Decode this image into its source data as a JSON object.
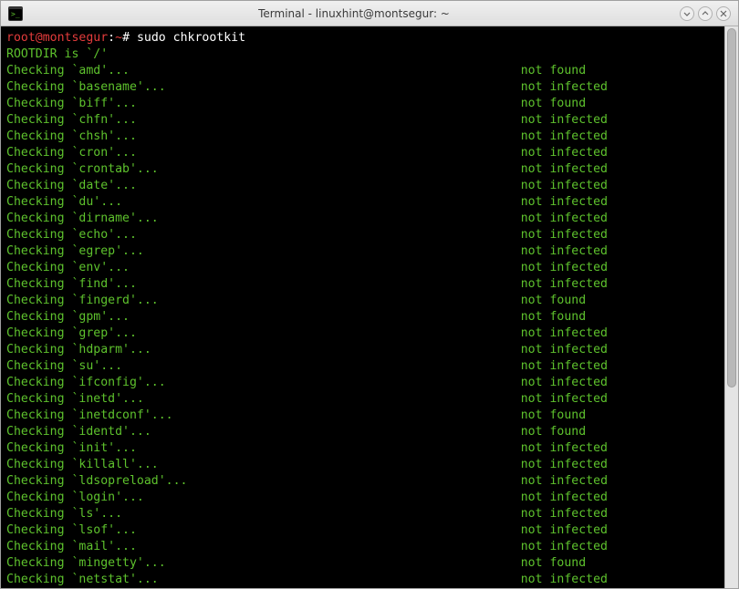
{
  "titlebar": {
    "title": "Terminal - linuxhint@montsegur: ~"
  },
  "prompt": {
    "user_host": "root@montsegur",
    "path": "~",
    "symbol": "#",
    "command": "sudo chkrootkit"
  },
  "rootdir_line": "ROOTDIR is `/'",
  "check_word": "Checking",
  "status_col": 71,
  "checks": [
    {
      "name": "amd",
      "status": "not found"
    },
    {
      "name": "basename",
      "status": "not infected"
    },
    {
      "name": "biff",
      "status": "not found"
    },
    {
      "name": "chfn",
      "status": "not infected"
    },
    {
      "name": "chsh",
      "status": "not infected"
    },
    {
      "name": "cron",
      "status": "not infected"
    },
    {
      "name": "crontab",
      "status": "not infected"
    },
    {
      "name": "date",
      "status": "not infected"
    },
    {
      "name": "du",
      "status": "not infected"
    },
    {
      "name": "dirname",
      "status": "not infected"
    },
    {
      "name": "echo",
      "status": "not infected"
    },
    {
      "name": "egrep",
      "status": "not infected"
    },
    {
      "name": "env",
      "status": "not infected"
    },
    {
      "name": "find",
      "status": "not infected"
    },
    {
      "name": "fingerd",
      "status": "not found"
    },
    {
      "name": "gpm",
      "status": "not found"
    },
    {
      "name": "grep",
      "status": "not infected"
    },
    {
      "name": "hdparm",
      "status": "not infected"
    },
    {
      "name": "su",
      "status": "not infected"
    },
    {
      "name": "ifconfig",
      "status": "not infected"
    },
    {
      "name": "inetd",
      "status": "not infected"
    },
    {
      "name": "inetdconf",
      "status": "not found"
    },
    {
      "name": "identd",
      "status": "not found"
    },
    {
      "name": "init",
      "status": "not infected"
    },
    {
      "name": "killall",
      "status": "not infected"
    },
    {
      "name": "ldsopreload",
      "status": "not infected"
    },
    {
      "name": "login",
      "status": "not infected"
    },
    {
      "name": "ls",
      "status": "not infected"
    },
    {
      "name": "lsof",
      "status": "not infected"
    },
    {
      "name": "mail",
      "status": "not infected"
    },
    {
      "name": "mingetty",
      "status": "not found"
    },
    {
      "name": "netstat",
      "status": "not infected"
    }
  ]
}
